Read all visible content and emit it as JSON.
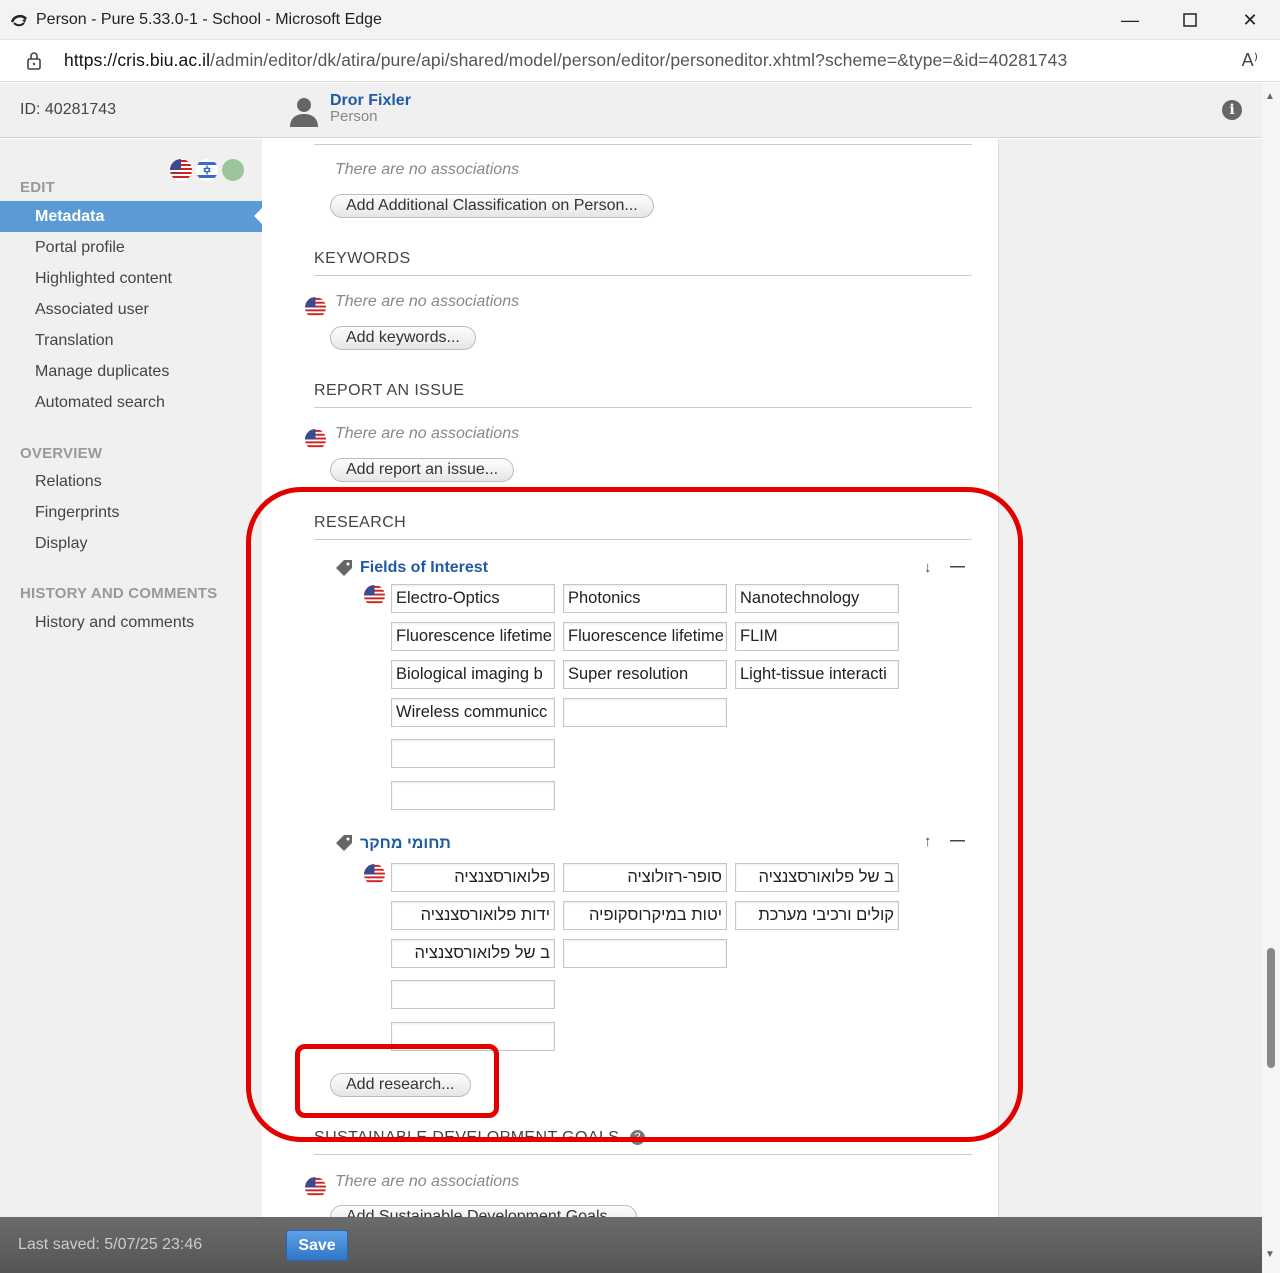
{
  "window": {
    "title": "Person - Pure 5.33.0-1 - School - Microsoft Edge",
    "url_host": "https://cris.biu.ac.il",
    "url_path": "/admin/editor/dk/atira/pure/api/shared/model/person/editor/personeditor.xhtml?scheme=&type=&id=40281743",
    "read_aloud": "A⁾"
  },
  "header": {
    "id_label": "ID: 40281743",
    "person_name": "Dror Fixler",
    "person_type": "Person"
  },
  "sidebar": {
    "edit_heading": "EDIT",
    "edit_items": [
      "Metadata",
      "Portal profile",
      "Highlighted content",
      "Associated user",
      "Translation",
      "Manage duplicates",
      "Automated search"
    ],
    "overview_heading": "OVERVIEW",
    "overview_items": [
      "Relations",
      "Fingerprints",
      "Display"
    ],
    "history_heading": "HISTORY AND COMMENTS",
    "history_items": [
      "History and comments"
    ]
  },
  "main": {
    "no_associations": "There are no associations",
    "add_classification_btn": "Add Additional Classification on Person...",
    "keywords_heading": "KEYWORDS",
    "add_keywords_btn": "Add keywords...",
    "report_heading": "REPORT AN ISSUE",
    "add_report_btn": "Add report an issue...",
    "research_heading": "RESEARCH",
    "fields_title": "Fields of Interest",
    "fields_values": [
      "Electro-Optics",
      "Photonics",
      "Nanotechnology",
      "Fluorescence lifetime",
      "Fluorescence lifetime",
      "FLIM",
      "Biological imaging b",
      "Super resolution",
      "Light-tissue interacti",
      "Wireless communicc",
      "",
      "",
      ""
    ],
    "hebrew_title": "תחומי מחקר",
    "hebrew_values": [
      "פלואורסצנציה",
      "סופר-רזולוציה",
      "ב של פלואורסצנציה",
      "ידות פלואורסצנציה",
      "יטות במיקרוסקופיה",
      "קולים ורכיבי מערכת",
      "ב של פלואורסצנציה",
      "",
      "",
      ""
    ],
    "add_research_btn": "Add research...",
    "sdg_heading": "SUSTAINABLE DEVELOPMENT GOALS",
    "add_sdg_btn": "Add Sustainable Development Goals..."
  },
  "footer": {
    "last_saved": "Last saved: 5/07/25 23:46",
    "save_label": "Save"
  },
  "colors": {
    "accent": "#5b9bd5",
    "link": "#1f5aa5",
    "annotation": "#e30000"
  }
}
